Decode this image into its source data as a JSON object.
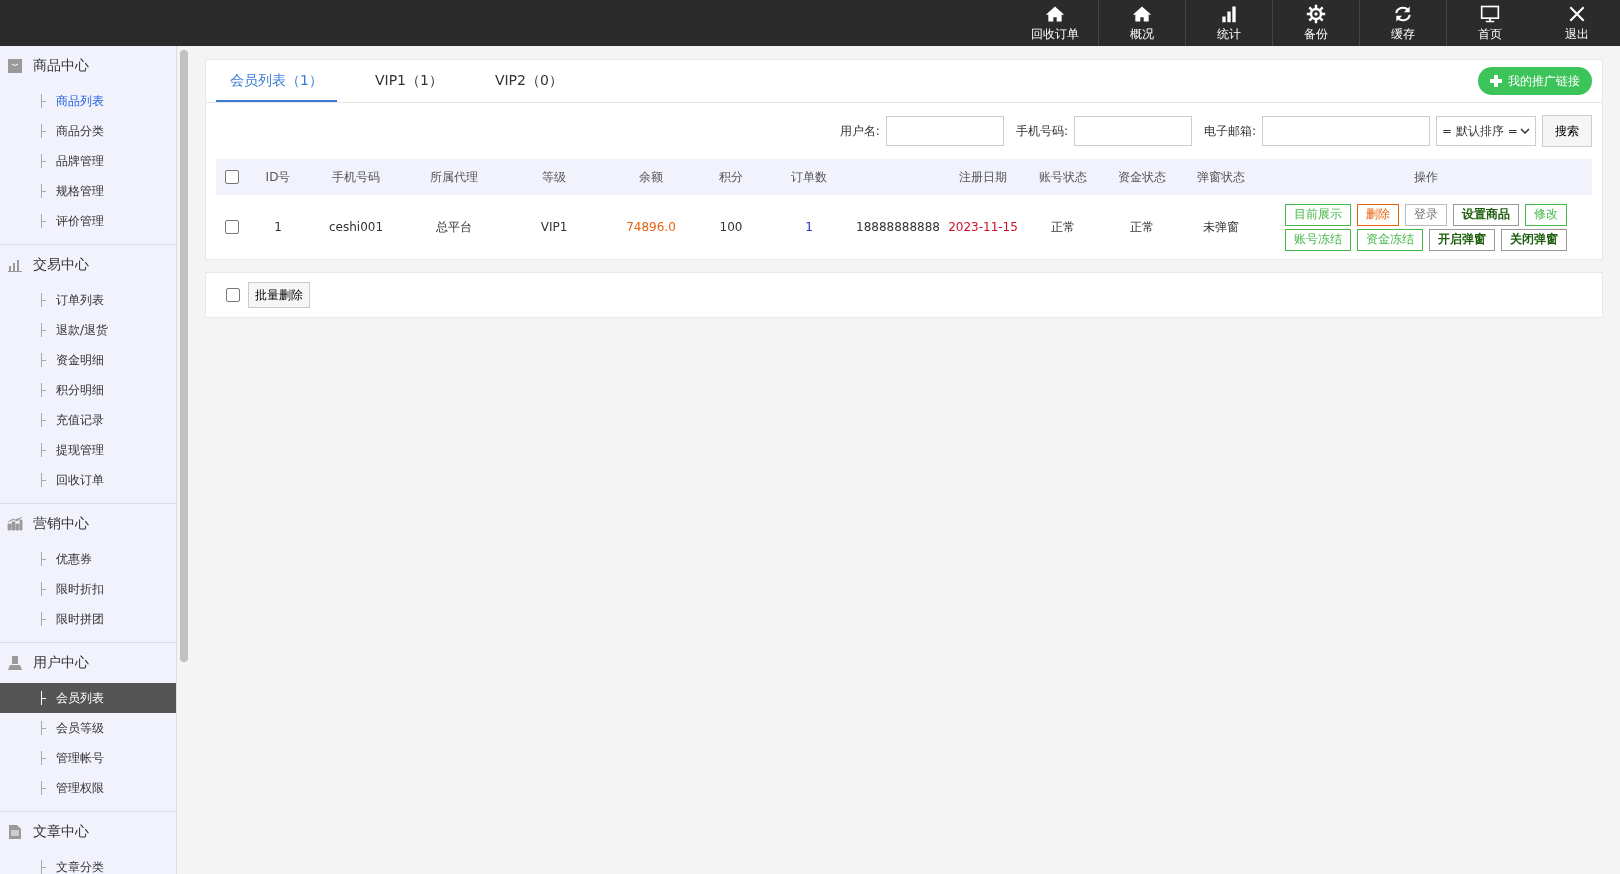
{
  "top_nav": [
    {
      "label": "回收订单",
      "kind": "home",
      "divider": false
    },
    {
      "label": "概况",
      "kind": "home",
      "divider": true
    },
    {
      "label": "统计",
      "kind": "bars",
      "divider": true
    },
    {
      "label": "备份",
      "kind": "gear",
      "divider": true
    },
    {
      "label": "缓存",
      "kind": "refresh",
      "divider": true
    },
    {
      "label": "首页",
      "kind": "monitor",
      "divider": true
    },
    {
      "label": "退出",
      "kind": "close",
      "divider": false
    }
  ],
  "sidebar": {
    "sections": [
      {
        "title": "商品中心",
        "kind": "bag",
        "items": [
          {
            "label": "商品列表",
            "selected": false,
            "current": true
          },
          {
            "label": "商品分类",
            "selected": false,
            "current": false
          },
          {
            "label": "品牌管理",
            "selected": false,
            "current": false
          },
          {
            "label": "规格管理",
            "selected": false,
            "current": false
          },
          {
            "label": "评价管理",
            "selected": false,
            "current": false
          }
        ]
      },
      {
        "title": "交易中心",
        "kind": "bars",
        "items": [
          {
            "label": "订单列表",
            "selected": false,
            "current": false
          },
          {
            "label": "退款/退货",
            "selected": false,
            "current": false
          },
          {
            "label": "资金明细",
            "selected": false,
            "current": false
          },
          {
            "label": "积分明细",
            "selected": false,
            "current": false
          },
          {
            "label": "充值记录",
            "selected": false,
            "current": false
          },
          {
            "label": "提现管理",
            "selected": false,
            "current": false
          },
          {
            "label": "回收订单",
            "selected": false,
            "current": false
          }
        ]
      },
      {
        "title": "营销中心",
        "kind": "chart",
        "items": [
          {
            "label": "优惠券",
            "selected": false,
            "current": false
          },
          {
            "label": "限时折扣",
            "selected": false,
            "current": false
          },
          {
            "label": "限时拼团",
            "selected": false,
            "current": false
          }
        ]
      },
      {
        "title": "用户中心",
        "kind": "user",
        "items": [
          {
            "label": "会员列表",
            "selected": true,
            "current": false
          },
          {
            "label": "会员等级",
            "selected": false,
            "current": false
          },
          {
            "label": "管理帐号",
            "selected": false,
            "current": false
          },
          {
            "label": "管理权限",
            "selected": false,
            "current": false
          }
        ]
      },
      {
        "title": "文章中心",
        "kind": "doc",
        "items": [
          {
            "label": "文章分类",
            "selected": false,
            "current": false
          }
        ]
      }
    ]
  },
  "tabs": [
    {
      "label": "会员列表（1）",
      "selected": true
    },
    {
      "label": "VIP1（1）",
      "selected": false
    },
    {
      "label": "VIP2（0）",
      "selected": false
    }
  ],
  "promo_button": {
    "label": "我的推广链接"
  },
  "filters": [
    {
      "label": "用户名:"
    },
    {
      "label": "手机号码:"
    },
    {
      "label": "电子邮箱:"
    }
  ],
  "sort_select": {
    "value": "= 默认排序 ="
  },
  "search_button": {
    "label": "搜索"
  },
  "table": {
    "select_all_checked": false,
    "columns": [
      "ID号",
      "手机号码",
      "所属代理",
      "等级",
      "余额",
      "积分",
      "订单数",
      "",
      "注册日期",
      "账号状态",
      "资金状态",
      "弹窗状态",
      "操作"
    ],
    "rows": [
      {
        "checked": false,
        "cells": [
          {
            "kind": "text",
            "text": "1"
          },
          {
            "kind": "text",
            "text": "ceshi001"
          },
          {
            "kind": "text",
            "text": "总平台"
          },
          {
            "kind": "text",
            "text": "VIP1"
          },
          {
            "kind": "money",
            "text": "74896.0"
          },
          {
            "kind": "text",
            "text": "100"
          },
          {
            "kind": "count",
            "text": "1"
          },
          {
            "kind": "text",
            "text": "18888888888"
          },
          {
            "kind": "date",
            "text": "2023-11-15"
          },
          {
            "kind": "text",
            "text": "正常"
          },
          {
            "kind": "text",
            "text": "正常"
          },
          {
            "kind": "text",
            "text": "未弹窗"
          }
        ],
        "actions": [
          [
            {
              "label": "目前展示",
              "kind": "success"
            },
            {
              "label": "删除",
              "kind": "danger"
            },
            {
              "label": "登录",
              "kind": "plain"
            },
            {
              "label": "设置商品",
              "kind": "strong"
            },
            {
              "label": "修改",
              "kind": "success"
            }
          ],
          [
            {
              "label": "账号冻结",
              "kind": "success"
            },
            {
              "label": "资金冻结",
              "kind": "success"
            },
            {
              "label": "开启弹窗",
              "kind": "strong"
            },
            {
              "label": "关闭弹窗",
              "kind": "strong"
            }
          ]
        ]
      }
    ]
  },
  "batch": {
    "checked": false,
    "button": "批量删除"
  }
}
